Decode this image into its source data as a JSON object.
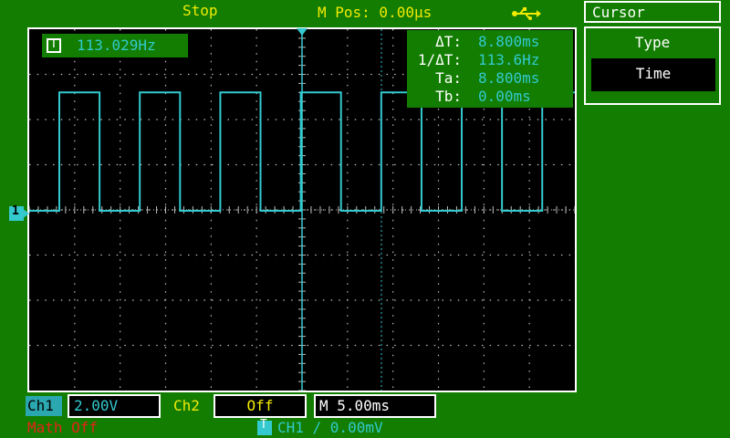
{
  "status": {
    "run_state": "Stop",
    "mpos": "M Pos: 0.00μs",
    "usb_icon": "usb-icon"
  },
  "measurement": {
    "icon_label": "T",
    "frequency": "113.029Hz"
  },
  "cursor_readout": {
    "delta_t_label": "ΔT:",
    "delta_t_value": "8.800ms",
    "inv_delta_t_label": "1/ΔT:",
    "inv_delta_t_value": "113.6Hz",
    "ta_label": "Ta:",
    "ta_value": "8.800ms",
    "tb_label": "Tb:",
    "tb_value": "0.00ms"
  },
  "menu": {
    "title": "Cursor",
    "type_label": "Type",
    "type_value": "Time"
  },
  "channel_marker": "1",
  "bottom": {
    "ch1_label": "Ch1",
    "ch1_scale": "2.00V",
    "ch2_label": "Ch2",
    "ch2_state": "Off",
    "timebase": "M 5.00ms",
    "math": "Math Off",
    "trigger_icon": "T",
    "trigger": "CH1  ∕  0.00mV"
  },
  "colors": {
    "background": "#127d00",
    "trace": "#33c9cf",
    "label": "#f2ea00",
    "warning": "#e2251a",
    "screen": "#000000"
  },
  "waveform": {
    "high_divisions": 2.6,
    "low_divisions": 0,
    "period_ms": 8.85,
    "duty_high": 0.5
  }
}
